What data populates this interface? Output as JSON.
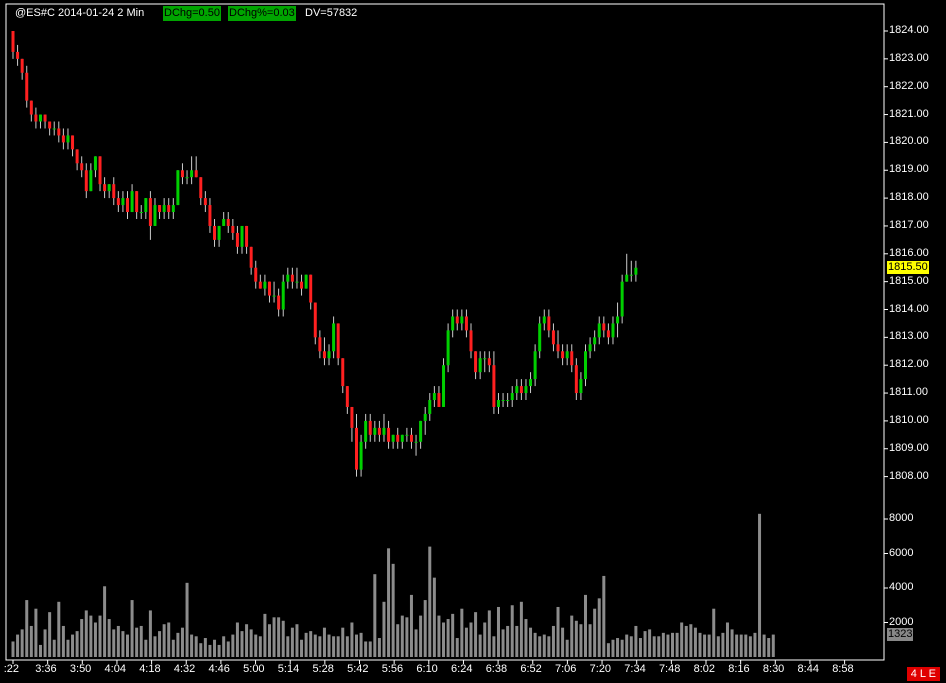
{
  "header": {
    "symbol_info": "@ES#C 2014-01-24 2 Min",
    "dchg_label": "DChg=0.50",
    "dchgpct_label": "DChg%=0.03",
    "dv_label": "DV=57832"
  },
  "status_badge": "4 L E",
  "last_price_label": "1815.50",
  "last_volume_label": "1323",
  "colors": {
    "up": "#00d000",
    "down": "#ff2020",
    "volume": "#8c8c8c",
    "axis": "#ffffff",
    "background": "#000000",
    "price_badge": "#ffff00"
  },
  "chart_data": {
    "type": "candlestick",
    "price_axis": {
      "ticks": [
        "1824.00",
        "1823.00",
        "1822.00",
        "1821.00",
        "1820.00",
        "1819.00",
        "1818.00",
        "1817.00",
        "1816.00",
        "1815.00",
        "1814.00",
        "1813.00",
        "1812.00",
        "1811.00",
        "1810.00",
        "1809.00",
        "1808.00"
      ],
      "range": [
        1807.5,
        1824.25
      ]
    },
    "volume_axis": {
      "ticks": [
        "8000",
        "6000",
        "4000",
        "2000"
      ],
      "range": [
        0,
        9500
      ]
    },
    "time_axis": {
      "ticks": [
        ":22",
        "3:36",
        "3:50",
        "4:04",
        "4:18",
        "4:32",
        "4:46",
        "5:00",
        "5:14",
        "5:28",
        "5:42",
        "5:56",
        "6:10",
        "6:24",
        "6:38",
        "6:52",
        "7:06",
        "7:20",
        "7:34",
        "7:48",
        "8:02",
        "8:16",
        "8:30",
        "8:44",
        "8:58"
      ]
    },
    "candles": [
      [
        1824.0,
        1824.0,
        1823.0,
        1823.25
      ],
      [
        1823.25,
        1823.5,
        1822.75,
        1823.0
      ],
      [
        1823.0,
        1823.0,
        1822.25,
        1822.5
      ],
      [
        1822.5,
        1822.75,
        1821.25,
        1821.5
      ],
      [
        1821.5,
        1821.5,
        1820.75,
        1821.0
      ],
      [
        1821.0,
        1821.25,
        1820.5,
        1820.75
      ],
      [
        1820.75,
        1821.0,
        1820.5,
        1821.0
      ],
      [
        1821.0,
        1821.0,
        1820.5,
        1820.75
      ],
      [
        1820.75,
        1820.75,
        1820.25,
        1820.5
      ],
      [
        1820.5,
        1820.75,
        1820.25,
        1820.5
      ],
      [
        1820.5,
        1820.75,
        1820.0,
        1820.25
      ],
      [
        1820.25,
        1820.5,
        1819.75,
        1820.0
      ],
      [
        1820.0,
        1820.5,
        1819.75,
        1820.25
      ],
      [
        1820.25,
        1820.25,
        1819.5,
        1819.75
      ],
      [
        1819.75,
        1819.75,
        1819.0,
        1819.25
      ],
      [
        1819.25,
        1819.5,
        1818.75,
        1819.0
      ],
      [
        1819.0,
        1819.25,
        1818.0,
        1818.25
      ],
      [
        1818.25,
        1819.25,
        1818.25,
        1819.0
      ],
      [
        1819.0,
        1819.5,
        1818.75,
        1819.5
      ],
      [
        1819.5,
        1819.5,
        1818.25,
        1818.5
      ],
      [
        1818.5,
        1818.75,
        1818.0,
        1818.25
      ],
      [
        1818.25,
        1818.5,
        1818.0,
        1818.5
      ],
      [
        1818.5,
        1818.75,
        1817.75,
        1818.0
      ],
      [
        1818.0,
        1818.25,
        1817.5,
        1817.75
      ],
      [
        1817.75,
        1818.25,
        1817.5,
        1818.0
      ],
      [
        1818.0,
        1818.25,
        1817.25,
        1817.5
      ],
      [
        1817.5,
        1818.5,
        1817.5,
        1818.25
      ],
      [
        1818.25,
        1818.25,
        1817.25,
        1817.5
      ],
      [
        1817.5,
        1817.75,
        1817.25,
        1817.5
      ],
      [
        1817.5,
        1818.0,
        1817.25,
        1818.0
      ],
      [
        1818.0,
        1818.25,
        1816.5,
        1817.0
      ],
      [
        1817.0,
        1818.0,
        1817.0,
        1817.75
      ],
      [
        1817.75,
        1817.75,
        1817.25,
        1817.5
      ],
      [
        1817.5,
        1818.0,
        1817.25,
        1817.75
      ],
      [
        1817.75,
        1818.0,
        1817.25,
        1817.5
      ],
      [
        1817.5,
        1818.0,
        1817.25,
        1817.75
      ],
      [
        1817.75,
        1819.0,
        1817.75,
        1819.0
      ],
      [
        1819.0,
        1819.25,
        1818.5,
        1818.75
      ],
      [
        1818.75,
        1819.0,
        1818.5,
        1818.75
      ],
      [
        1818.75,
        1819.5,
        1818.5,
        1819.0
      ],
      [
        1819.0,
        1819.5,
        1818.75,
        1818.75
      ],
      [
        1818.75,
        1818.75,
        1817.75,
        1818.0
      ],
      [
        1818.0,
        1818.25,
        1817.5,
        1817.75
      ],
      [
        1817.75,
        1818.0,
        1816.75,
        1817.0
      ],
      [
        1817.0,
        1817.25,
        1816.25,
        1816.5
      ],
      [
        1816.5,
        1817.0,
        1816.25,
        1817.0
      ],
      [
        1817.0,
        1817.5,
        1817.0,
        1817.25
      ],
      [
        1817.25,
        1817.5,
        1816.75,
        1817.0
      ],
      [
        1817.0,
        1817.25,
        1816.5,
        1816.75
      ],
      [
        1816.75,
        1817.0,
        1816.0,
        1816.25
      ],
      [
        1816.25,
        1817.0,
        1816.0,
        1817.0
      ],
      [
        1817.0,
        1817.0,
        1816.0,
        1816.25
      ],
      [
        1816.25,
        1816.25,
        1815.25,
        1815.5
      ],
      [
        1815.5,
        1815.75,
        1814.75,
        1815.0
      ],
      [
        1815.0,
        1815.25,
        1814.75,
        1814.75
      ],
      [
        1814.75,
        1815.25,
        1814.5,
        1815.0
      ],
      [
        1815.0,
        1815.0,
        1814.25,
        1814.5
      ],
      [
        1814.5,
        1815.0,
        1814.25,
        1814.5
      ],
      [
        1814.5,
        1814.75,
        1813.75,
        1814.0
      ],
      [
        1814.0,
        1815.25,
        1813.75,
        1815.0
      ],
      [
        1815.0,
        1815.5,
        1814.75,
        1815.25
      ],
      [
        1815.25,
        1815.5,
        1814.75,
        1815.0
      ],
      [
        1815.0,
        1815.5,
        1814.75,
        1815.0
      ],
      [
        1815.0,
        1815.25,
        1814.5,
        1814.75
      ],
      [
        1814.75,
        1815.25,
        1814.75,
        1815.25
      ],
      [
        1815.25,
        1815.25,
        1814.0,
        1814.25
      ],
      [
        1814.25,
        1814.25,
        1812.75,
        1813.0
      ],
      [
        1813.0,
        1813.25,
        1812.25,
        1812.5
      ],
      [
        1812.5,
        1813.0,
        1812.0,
        1812.25
      ],
      [
        1812.25,
        1812.75,
        1812.0,
        1812.5
      ],
      [
        1812.5,
        1813.75,
        1812.25,
        1813.5
      ],
      [
        1813.5,
        1813.5,
        1812.0,
        1812.25
      ],
      [
        1812.25,
        1812.25,
        1811.0,
        1811.25
      ],
      [
        1811.25,
        1811.25,
        1810.25,
        1810.5
      ],
      [
        1810.5,
        1810.5,
        1809.25,
        1809.75
      ],
      [
        1809.75,
        1810.25,
        1808.0,
        1808.25
      ],
      [
        1808.25,
        1809.5,
        1808.0,
        1809.25
      ],
      [
        1809.25,
        1810.25,
        1809.0,
        1810.0
      ],
      [
        1810.0,
        1810.25,
        1809.25,
        1809.5
      ],
      [
        1809.5,
        1810.0,
        1809.25,
        1809.75
      ],
      [
        1809.75,
        1810.0,
        1809.25,
        1809.5
      ],
      [
        1809.5,
        1810.25,
        1809.25,
        1809.75
      ],
      [
        1809.75,
        1810.0,
        1809.0,
        1809.25
      ],
      [
        1809.25,
        1809.5,
        1809.0,
        1809.5
      ],
      [
        1809.5,
        1809.75,
        1809.0,
        1809.25
      ],
      [
        1809.25,
        1809.5,
        1809.0,
        1809.5
      ],
      [
        1809.5,
        1809.75,
        1809.25,
        1809.5
      ],
      [
        1809.5,
        1809.75,
        1809.0,
        1809.25
      ],
      [
        1809.25,
        1809.5,
        1808.75,
        1809.25
      ],
      [
        1809.25,
        1810.0,
        1809.0,
        1810.0
      ],
      [
        1810.0,
        1810.5,
        1809.5,
        1810.25
      ],
      [
        1810.25,
        1811.0,
        1810.0,
        1810.75
      ],
      [
        1810.75,
        1811.25,
        1810.5,
        1811.0
      ],
      [
        1811.0,
        1811.25,
        1810.5,
        1810.5
      ],
      [
        1810.5,
        1812.25,
        1810.5,
        1812.0
      ],
      [
        1812.0,
        1813.5,
        1811.75,
        1813.25
      ],
      [
        1813.25,
        1814.0,
        1813.0,
        1813.75
      ],
      [
        1813.75,
        1814.0,
        1813.25,
        1813.5
      ],
      [
        1813.5,
        1814.0,
        1813.25,
        1813.75
      ],
      [
        1813.75,
        1814.0,
        1813.0,
        1813.25
      ],
      [
        1813.25,
        1813.5,
        1812.25,
        1812.5
      ],
      [
        1812.5,
        1812.5,
        1811.5,
        1811.75
      ],
      [
        1811.75,
        1812.5,
        1811.5,
        1812.25
      ],
      [
        1812.25,
        1812.5,
        1811.75,
        1812.25
      ],
      [
        1812.25,
        1812.5,
        1811.75,
        1812.0
      ],
      [
        1812.0,
        1812.5,
        1810.25,
        1810.5
      ],
      [
        1810.5,
        1811.0,
        1810.25,
        1810.75
      ],
      [
        1810.75,
        1811.0,
        1810.5,
        1810.75
      ],
      [
        1810.75,
        1811.0,
        1810.5,
        1810.75
      ],
      [
        1810.75,
        1811.25,
        1810.5,
        1811.0
      ],
      [
        1811.0,
        1811.5,
        1810.75,
        1811.25
      ],
      [
        1811.25,
        1811.5,
        1810.75,
        1811.0
      ],
      [
        1811.0,
        1811.5,
        1810.75,
        1811.25
      ],
      [
        1811.25,
        1811.75,
        1811.0,
        1811.5
      ],
      [
        1811.5,
        1812.75,
        1811.25,
        1812.5
      ],
      [
        1812.5,
        1813.75,
        1812.25,
        1813.5
      ],
      [
        1813.5,
        1814.0,
        1813.25,
        1813.75
      ],
      [
        1813.75,
        1814.0,
        1813.0,
        1813.25
      ],
      [
        1813.25,
        1813.5,
        1812.5,
        1812.75
      ],
      [
        1812.75,
        1813.25,
        1812.25,
        1812.5
      ],
      [
        1812.5,
        1812.75,
        1812.0,
        1812.25
      ],
      [
        1812.25,
        1812.75,
        1812.0,
        1812.5
      ],
      [
        1812.5,
        1812.75,
        1811.75,
        1812.0
      ],
      [
        1812.0,
        1812.25,
        1810.75,
        1811.0
      ],
      [
        1811.0,
        1811.75,
        1810.75,
        1811.5
      ],
      [
        1811.5,
        1812.75,
        1811.25,
        1812.5
      ],
      [
        1812.5,
        1813.0,
        1812.25,
        1812.75
      ],
      [
        1812.75,
        1813.25,
        1812.5,
        1813.0
      ],
      [
        1813.0,
        1813.75,
        1812.75,
        1813.5
      ],
      [
        1813.5,
        1813.75,
        1813.0,
        1813.25
      ],
      [
        1813.25,
        1813.5,
        1812.75,
        1813.0
      ],
      [
        1813.0,
        1813.75,
        1812.75,
        1813.5
      ],
      [
        1813.5,
        1814.25,
        1813.0,
        1813.75
      ],
      [
        1813.75,
        1815.25,
        1813.5,
        1815.0
      ],
      [
        1815.0,
        1816.0,
        1815.0,
        1815.25
      ],
      [
        1815.25,
        1815.75,
        1815.0,
        1815.25
      ],
      [
        1815.25,
        1815.75,
        1815.0,
        1815.5
      ]
    ],
    "volume": [
      900,
      1300,
      1600,
      3300,
      1800,
      2800,
      700,
      1600,
      2600,
      1000,
      3200,
      1800,
      1000,
      1300,
      1500,
      2200,
      2700,
      2400,
      2000,
      2400,
      4100,
      2200,
      1600,
      1800,
      1500,
      1300,
      3300,
      1700,
      1800,
      1000,
      2700,
      1200,
      1500,
      1900,
      2000,
      1000,
      1400,
      1700,
      4300,
      1300,
      1200,
      800,
      1100,
      700,
      1000,
      700,
      1200,
      900,
      1300,
      2000,
      1500,
      1900,
      1600,
      1300,
      1200,
      2500,
      1900,
      2300,
      2300,
      2100,
      1200,
      1700,
      1900,
      1000,
      1400,
      1500,
      1300,
      1200,
      1700,
      1300,
      1200,
      1200,
      1700,
      1200,
      2000,
      1300,
      1400,
      900,
      900,
      4800,
      1100,
      3200,
      6300,
      5400,
      1900,
      2400,
      2300,
      3600,
      1600,
      2400,
      3300,
      6400,
      4600,
      2400,
      2000,
      2200,
      2500,
      1100,
      2800,
      1700,
      2000,
      2600,
      1300,
      2000,
      2700,
      1200,
      2900,
      1600,
      1800,
      3000,
      1800,
      3200,
      2200,
      1700,
      1400,
      1200,
      1300,
      1200,
      1800,
      2900,
      1700,
      1000,
      2400,
      2100,
      1900,
      3600,
      1900,
      2800,
      3400,
      4700,
      800,
      1000,
      1100,
      1000,
      1300,
      1200,
      1800,
      1100,
      1500,
      1600,
      1200,
      1200,
      1400,
      1300,
      1400,
      1400,
      2000,
      1800,
      1900,
      1700,
      1400,
      1300,
      1300,
      2800,
      1200,
      1400,
      2000,
      1600,
      1300,
      1300,
      1300,
      1200,
      1400,
      8300,
      1300,
      1100,
      1300
    ]
  }
}
